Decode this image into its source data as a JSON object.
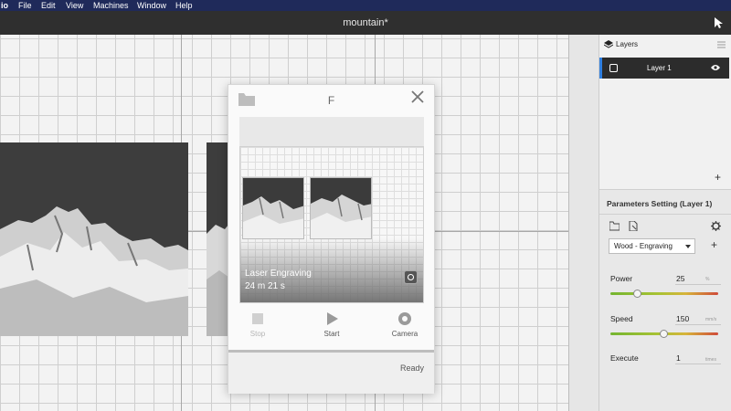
{
  "menubar": {
    "app": "io",
    "items": [
      "File",
      "Edit",
      "View",
      "Machines",
      "Window",
      "Help"
    ]
  },
  "window": {
    "title": "mountain*"
  },
  "dialog": {
    "title": "F",
    "preview": {
      "status_label": "Laser Engraving",
      "time_label": "24 m 21 s"
    },
    "actions": {
      "stop": "Stop",
      "start": "Start",
      "camera": "Camera"
    },
    "status": "Ready"
  },
  "layers": {
    "title": "Layers",
    "items": [
      {
        "name": "Layer 1"
      }
    ],
    "add": "+"
  },
  "params": {
    "title": "Parameters Setting (Layer 1)",
    "preset": "Wood - Engraving",
    "add": "+",
    "power": {
      "label": "Power",
      "value": "25",
      "unit": "%",
      "slider_fraction": 0.25
    },
    "speed": {
      "label": "Speed",
      "value": "150",
      "unit": "mm/s",
      "slider_fraction": 0.5
    },
    "execute": {
      "label": "Execute",
      "value": "1",
      "unit": "times"
    }
  },
  "colors": {
    "accent": "#2f7fe0",
    "menubar": "#1f2a5a",
    "titlebar": "#2f2f2f"
  }
}
